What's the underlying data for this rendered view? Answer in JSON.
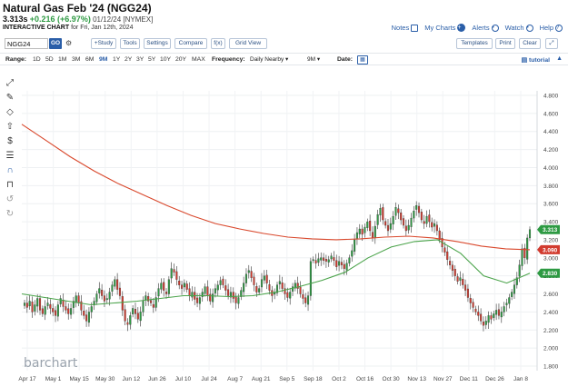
{
  "header": {
    "title": "Natural Gas Feb '24 (NGG24)",
    "last": "3.313s",
    "change": "+0.216 (+6.97%)",
    "date_exchange": "01/12/24 [NYMEX]",
    "chart_kind": "INTERACTIVE CHART",
    "chart_for": "for Fri, Jan 12th, 2024",
    "links": {
      "notes": "Notes",
      "my_charts": "My Charts",
      "alerts": "Alerts",
      "watch": "Watch",
      "help": "Help"
    }
  },
  "toolbar": {
    "symbol_value": "NGG24",
    "go": "GO",
    "study": "+Study",
    "tools": "Tools",
    "settings": "Settings",
    "compare": "Compare",
    "fx": "f(x)",
    "grid_view": "Grid View",
    "templates": "Templates",
    "print": "Print",
    "clear": "Clear"
  },
  "range_bar": {
    "range_label": "Range:",
    "ranges": [
      "1D",
      "5D",
      "1M",
      "3M",
      "6M",
      "9M",
      "1Y",
      "2Y",
      "3Y",
      "5Y",
      "10Y",
      "20Y",
      "MAX"
    ],
    "active_range": "9M",
    "frequency_label": "Frequency:",
    "frequency_value": "Daily Nearby",
    "period_value": "9M",
    "date_label": "Date:",
    "tutorial": "tutorial"
  },
  "left_tools": [
    "line-tool-icon",
    "pencil-icon",
    "shapes-icon",
    "pointer-icon",
    "dollar-icon",
    "fib-icon",
    "magnet-icon",
    "lock-icon",
    "undo-icon",
    "redo-icon"
  ],
  "watermark": "barchart",
  "colors": {
    "up": "#2e9a43",
    "down": "#d23b2f",
    "ma_slow": "#d9482c",
    "ma_fast": "#4aa34a",
    "link": "#2a5ea8"
  },
  "chart_data": {
    "type": "candlestick",
    "y_ticks": [
      1.8,
      2.0,
      2.2,
      2.4,
      2.6,
      2.8,
      3.0,
      3.2,
      3.4,
      3.6,
      3.8,
      4.0,
      4.2,
      4.4,
      4.6,
      4.8
    ],
    "y_tick_labels": [
      "1.800",
      "2.000",
      "2.200",
      "2.400",
      "2.600",
      "2.800",
      "3.000",
      "3.200",
      "3.400",
      "3.600",
      "3.800",
      "4.000",
      "4.200",
      "4.400",
      "4.600",
      "4.800"
    ],
    "ylim": [
      1.75,
      4.85
    ],
    "x_tick_labels": [
      "Apr 17",
      "May 1",
      "May 15",
      "May 30",
      "Jun 12",
      "Jun 26",
      "Jul 10",
      "Jul 24",
      "Aug 7",
      "Aug 21",
      "Sep 5",
      "Sep 18",
      "Oct 2",
      "Oct 16",
      "Oct 30",
      "Nov 13",
      "Nov 27",
      "Dec 11",
      "Dec 26",
      "Jan 8"
    ],
    "closes": [
      2.5,
      2.45,
      2.52,
      2.4,
      2.48,
      2.55,
      2.42,
      2.38,
      2.46,
      2.5,
      2.44,
      2.4,
      2.36,
      2.48,
      2.55,
      2.46,
      2.42,
      2.38,
      2.44,
      2.52,
      2.58,
      2.5,
      2.42,
      2.36,
      2.3,
      2.4,
      2.46,
      2.52,
      2.6,
      2.66,
      2.58,
      2.52,
      2.55,
      2.62,
      2.7,
      2.76,
      2.65,
      2.58,
      2.42,
      2.3,
      2.26,
      2.36,
      2.44,
      2.38,
      2.32,
      2.4,
      2.52,
      2.58,
      2.52,
      2.5,
      2.45,
      2.56,
      2.66,
      2.72,
      2.64,
      2.6,
      2.76,
      2.88,
      2.84,
      2.76,
      2.7,
      2.66,
      2.72,
      2.65,
      2.58,
      2.62,
      2.54,
      2.5,
      2.56,
      2.62,
      2.68,
      2.58,
      2.52,
      2.6,
      2.66,
      2.7,
      2.75,
      2.7,
      2.64,
      2.58,
      2.62,
      2.55,
      2.5,
      2.56,
      2.64,
      2.72,
      2.82,
      2.86,
      2.78,
      2.7,
      2.62,
      2.66,
      2.76,
      2.8,
      2.72,
      2.64,
      2.58,
      2.62,
      2.7,
      2.74,
      2.66,
      2.6,
      2.56,
      2.62,
      2.68,
      2.72,
      2.66,
      2.6,
      2.55,
      2.5,
      2.58,
      2.96,
      2.98,
      2.94,
      2.99,
      3.0,
      2.97,
      2.96,
      2.98,
      3.02,
      2.97,
      2.9,
      2.96,
      2.92,
      2.88,
      2.94,
      3.0,
      3.08,
      3.2,
      3.28,
      3.32,
      3.26,
      3.34,
      3.4,
      3.3,
      3.22,
      3.35,
      3.48,
      3.55,
      3.42,
      3.36,
      3.3,
      3.38,
      3.46,
      3.56,
      3.5,
      3.42,
      3.36,
      3.3,
      3.36,
      3.44,
      3.52,
      3.58,
      3.5,
      3.42,
      3.38,
      3.46,
      3.4,
      3.34,
      3.38,
      3.3,
      3.2,
      3.12,
      3.06,
      2.98,
      2.92,
      2.86,
      2.8,
      2.74,
      2.78,
      2.7,
      2.64,
      2.56,
      2.5,
      2.45,
      2.4,
      2.36,
      2.3,
      2.25,
      2.3,
      2.36,
      2.32,
      2.38,
      2.42,
      2.36,
      2.4,
      2.46,
      2.5,
      2.56,
      2.62,
      2.7,
      2.78,
      2.92,
      3.1,
      3.0,
      3.22,
      3.313
    ],
    "ma_slow": [
      4.48,
      4.3,
      4.12,
      3.96,
      3.82,
      3.7,
      3.58,
      3.47,
      3.38,
      3.32,
      3.27,
      3.23,
      3.21,
      3.2,
      3.21,
      3.23,
      3.24,
      3.22,
      3.18,
      3.13,
      3.1,
      3.09
    ],
    "ma_fast": [
      2.6,
      2.56,
      2.52,
      2.48,
      2.5,
      2.52,
      2.55,
      2.58,
      2.58,
      2.57,
      2.58,
      2.62,
      2.68,
      2.75,
      2.84,
      3.0,
      3.12,
      3.18,
      3.2,
      3.05,
      2.8,
      2.72,
      2.83
    ],
    "markers": [
      {
        "label": "3.313",
        "value": 3.313,
        "color": "#2e9a43"
      },
      {
        "label": "3.090",
        "value": 3.09,
        "color": "#d23b2f"
      },
      {
        "label": "2.830",
        "value": 2.83,
        "color": "#2e9a43"
      }
    ]
  }
}
